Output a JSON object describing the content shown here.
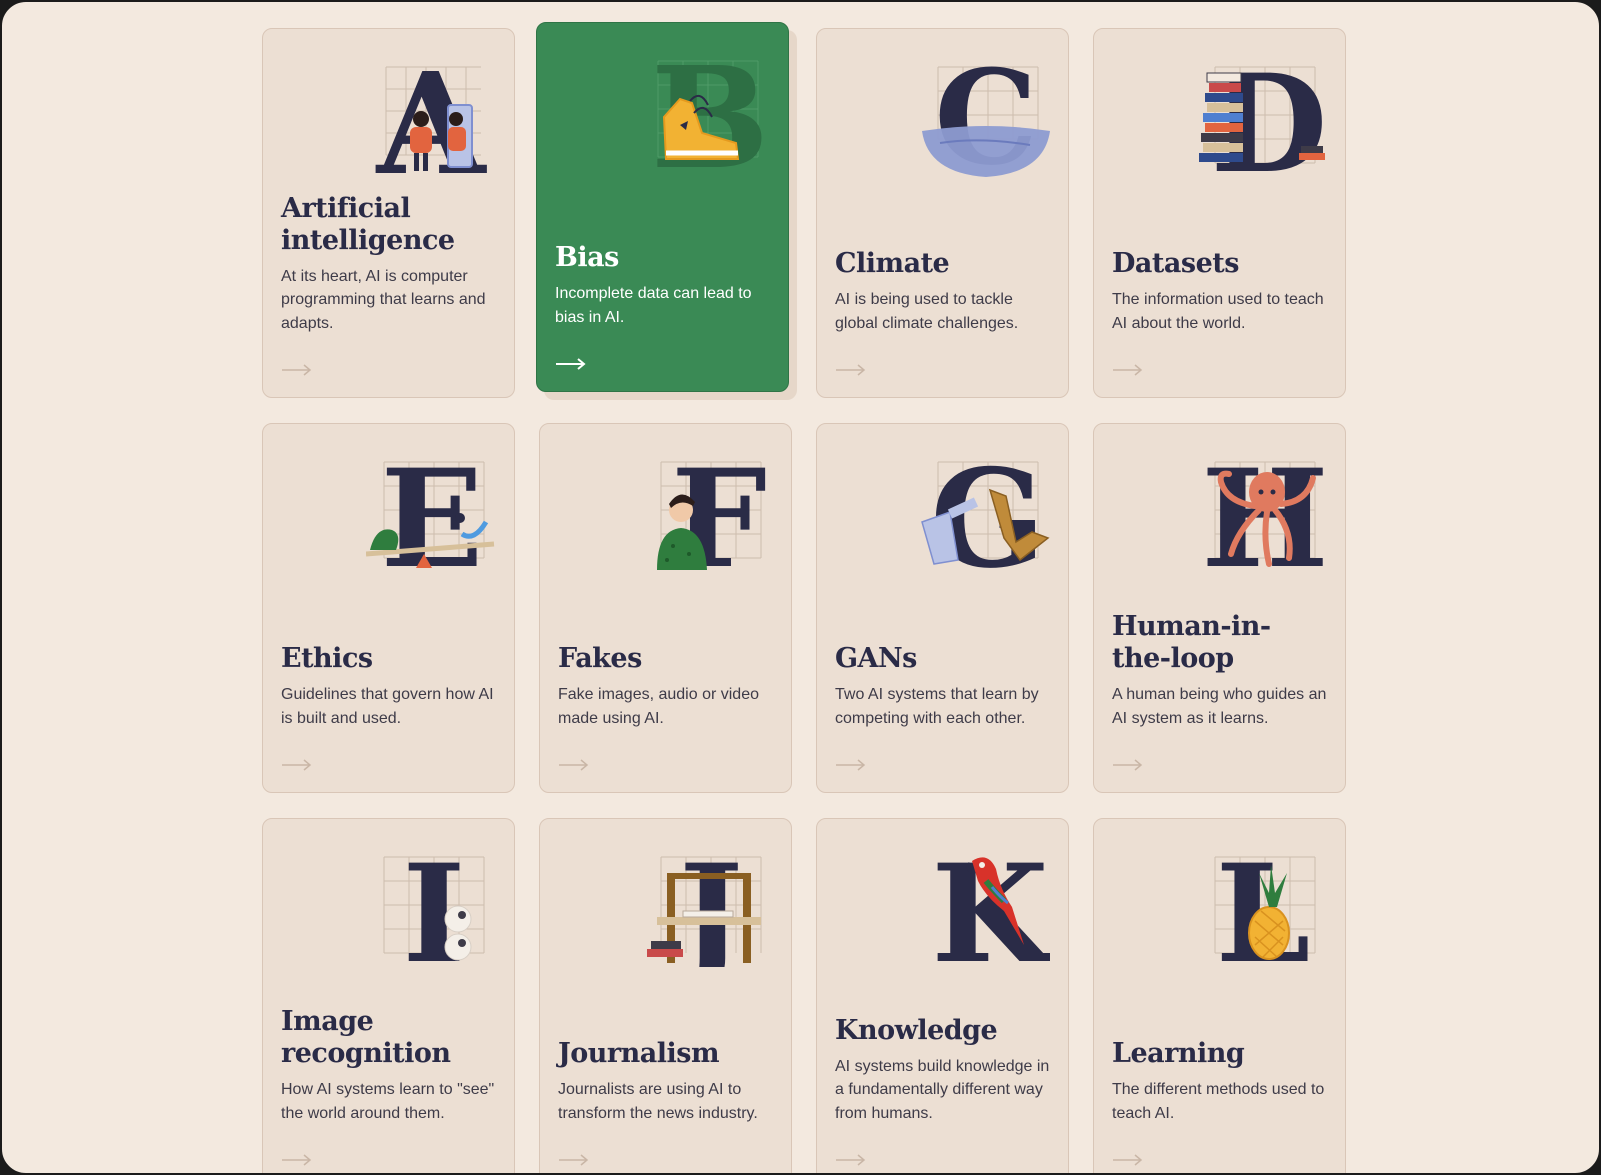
{
  "colors": {
    "page_background": "#f3e9df",
    "card_background": "#ecdfd3",
    "card_border": "#d9c6b7",
    "active_card": "#3a8a55",
    "letter_navy": "#2a2b47"
  },
  "cards": [
    {
      "letter": "A",
      "title": "Artificial intelligence",
      "description": "At its heart, AI is computer programming that learns and adapts.",
      "icon": "people-mirror-illustration",
      "active": false
    },
    {
      "letter": "B",
      "title": "Bias",
      "description": "Incomplete data can lead to bias in AI.",
      "icon": "sneaker-illustration",
      "active": true
    },
    {
      "letter": "C",
      "title": "Climate",
      "description": "AI is being used to tackle global climate challenges.",
      "icon": "water-bowl-illustration",
      "active": false
    },
    {
      "letter": "D",
      "title": "Datasets",
      "description": "The information used to teach AI about the world.",
      "icon": "book-stack-illustration",
      "active": false
    },
    {
      "letter": "E",
      "title": "Ethics",
      "description": "Guidelines that govern how AI is built and used.",
      "icon": "seesaw-illustration",
      "active": false
    },
    {
      "letter": "F",
      "title": "Fakes",
      "description": "Fake images, audio or video made using AI.",
      "icon": "person-illustration",
      "active": false
    },
    {
      "letter": "G",
      "title": "GANs",
      "description": "Two AI systems that learn by competing with each other.",
      "icon": "robot-arms-illustration",
      "active": false
    },
    {
      "letter": "H",
      "title": "Human-in-the-loop",
      "description": "A human being who guides an AI system as it learns.",
      "icon": "octopus-illustration",
      "active": false
    },
    {
      "letter": "I",
      "title": "Image recognition",
      "description": "How AI systems learn to \"see\" the world around them.",
      "icon": "eyeballs-illustration",
      "active": false
    },
    {
      "letter": "J",
      "title": "Journalism",
      "description": "Journalists are using AI to transform the news industry.",
      "icon": "press-desk-illustration",
      "active": false
    },
    {
      "letter": "K",
      "title": "Knowledge",
      "description": "AI systems build knowledge in a fundamentally different way from humans.",
      "icon": "parrot-illustration",
      "active": false
    },
    {
      "letter": "L",
      "title": "Learning",
      "description": "The different methods used to teach AI.",
      "icon": "pineapple-illustration",
      "active": false
    }
  ]
}
